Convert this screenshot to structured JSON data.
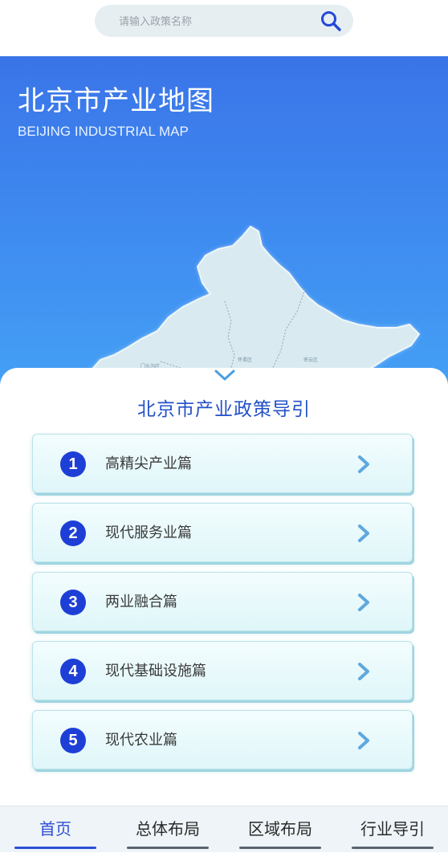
{
  "search": {
    "placeholder": "请输入政策名称"
  },
  "hero": {
    "title": "北京市产业地图",
    "subtitle": "BEIJING INDUSTRIAL MAP",
    "map_labels": [
      "门头沟区",
      "怀柔区",
      "密云区"
    ]
  },
  "panel": {
    "title": "北京市产业政策导引",
    "items": [
      {
        "number": "1",
        "label": "高精尖产业篇"
      },
      {
        "number": "2",
        "label": "现代服务业篇"
      },
      {
        "number": "3",
        "label": "两业融合篇"
      },
      {
        "number": "4",
        "label": "现代基础设施篇"
      },
      {
        "number": "5",
        "label": "现代农业篇"
      }
    ]
  },
  "nav": {
    "tabs": [
      {
        "label": "首页",
        "active": true
      },
      {
        "label": "总体布局",
        "active": false
      },
      {
        "label": "区域布局",
        "active": false
      },
      {
        "label": "行业导引",
        "active": false
      }
    ]
  },
  "icons": {
    "search": "search-icon",
    "collapse": "chevron-down-icon",
    "item_arrow": "chevron-right-icon"
  },
  "colors": {
    "brand_blue": "#2351c8",
    "badge_blue": "#1e3fd6",
    "active_tab": "#2d4fd6",
    "hero_top": "#3a74e8",
    "hero_bottom": "#46a5f5",
    "card_bg": "#e6f8fa",
    "arrow": "#5fa8de"
  }
}
